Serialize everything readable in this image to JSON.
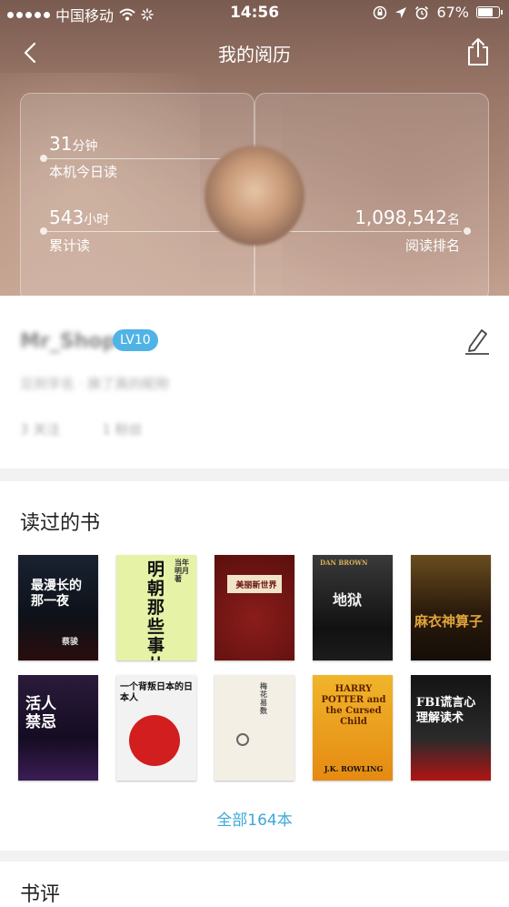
{
  "status_bar": {
    "carrier": "中国移动",
    "time": "14:56",
    "battery": "67%"
  },
  "nav": {
    "title": "我的阅历"
  },
  "stats": {
    "today": {
      "value": "31",
      "unit": "分钟",
      "label": "本机今日读"
    },
    "total": {
      "value": "543",
      "unit": "小时",
      "label": "累计读"
    },
    "rank": {
      "value": "1,098,542",
      "unit": "名",
      "label": "阅读排名"
    }
  },
  "profile": {
    "username": "Mr_Shop",
    "level": "LV10",
    "signature": "见到字名 · 换了真的昵称",
    "following": "3 关注",
    "followers": "1 粉丝"
  },
  "books_section": {
    "title": "读过的书",
    "books": [
      {
        "title": "最漫长的那一夜",
        "author": "蔡骏"
      },
      {
        "title": "明朝那些事儿",
        "author": "当年明月 著"
      },
      {
        "title": "美丽新世界",
        "author": ""
      },
      {
        "title": "地狱",
        "author": "DAN BROWN"
      },
      {
        "title": "麻衣神算子",
        "author": ""
      },
      {
        "title": "活人禁忌",
        "author": ""
      },
      {
        "title": "一个背叛日本的日本人",
        "author": ""
      },
      {
        "title": "梅花易数",
        "author": ""
      },
      {
        "title": "HARRY POTTER and the Cursed Child",
        "author": "J.K. ROWLING"
      },
      {
        "title": "FBI谎言心理解读术",
        "author": ""
      }
    ],
    "all_label": "全部164本"
  },
  "reviews_section": {
    "title": "书评"
  }
}
